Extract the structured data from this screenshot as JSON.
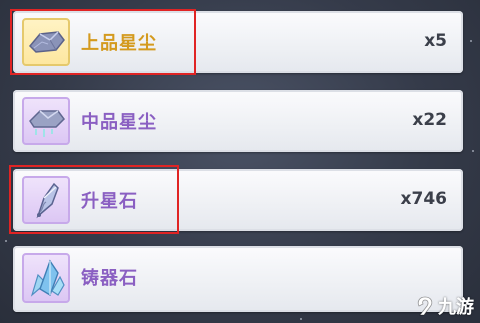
{
  "items": [
    {
      "name": "上品星尘",
      "quantity": "x5",
      "icon": "gem-stardust-high-icon"
    },
    {
      "name": "中品星尘",
      "quantity": "x22",
      "icon": "gem-stardust-mid-icon"
    },
    {
      "name": "升星石",
      "quantity": "x746",
      "icon": "feather-crystal-icon"
    },
    {
      "name": "铸器石",
      "quantity": "",
      "icon": "blue-crystal-icon"
    }
  ],
  "watermark": {
    "text": "九游"
  },
  "colors": {
    "highlight": "#e02424",
    "gold_text": "#d49a1e",
    "purple_text": "#8a5fc2"
  }
}
